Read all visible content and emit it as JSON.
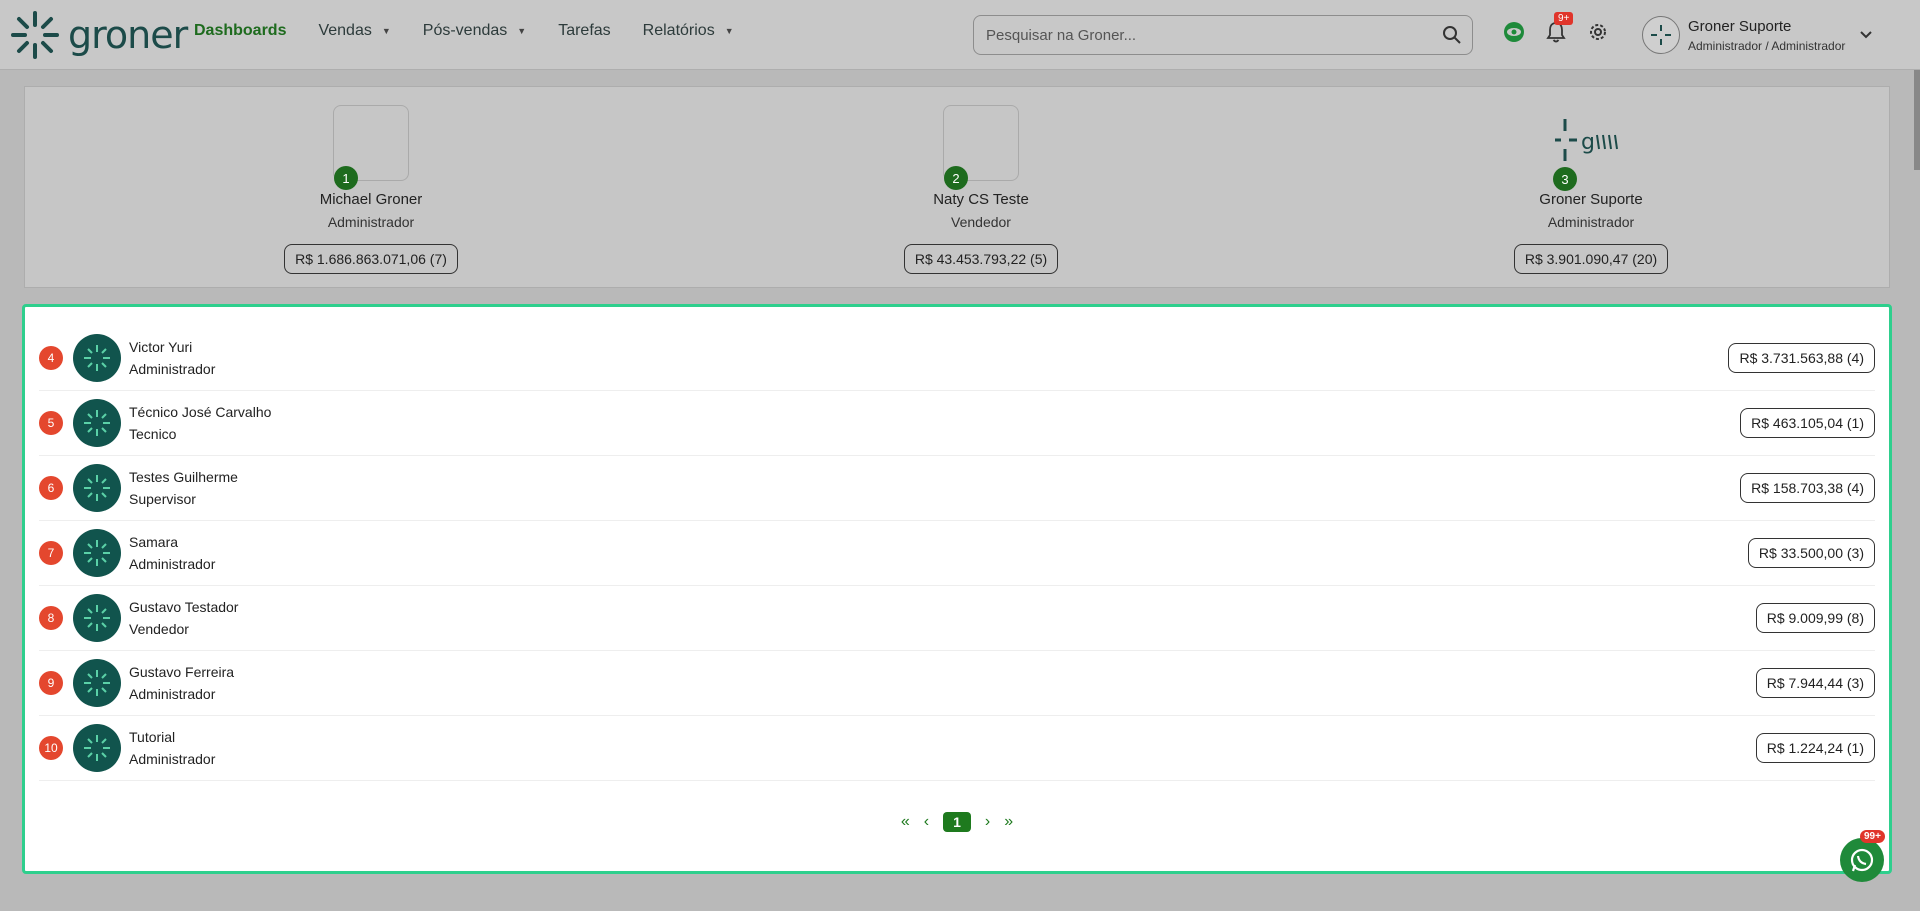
{
  "header": {
    "logo_text": "groner",
    "nav": [
      {
        "label": "Dashboards",
        "active": true,
        "dropdown": false
      },
      {
        "label": "Vendas",
        "active": false,
        "dropdown": true
      },
      {
        "label": "Pós-vendas",
        "active": false,
        "dropdown": true
      },
      {
        "label": "Tarefas",
        "active": false,
        "dropdown": false
      },
      {
        "label": "Relatórios",
        "active": false,
        "dropdown": true
      }
    ],
    "search_placeholder": "Pesquisar na Groner...",
    "notification_count": "9+",
    "user": {
      "name": "Groner Suporte",
      "role": "Administrador / Administrador"
    }
  },
  "podium": [
    {
      "rank": "1",
      "name": "Michael Groner",
      "role": "Administrador",
      "value": "R$ 1.686.863.071,06 (7)"
    },
    {
      "rank": "2",
      "name": "Naty CS Teste",
      "role": "Vendedor",
      "value": "R$ 43.453.793,22 (5)"
    },
    {
      "rank": "3",
      "name": "Groner Suporte",
      "role": "Administrador",
      "value": "R$ 3.901.090,47 (20)"
    }
  ],
  "ranking": [
    {
      "rank": "4",
      "name": "Victor Yuri",
      "role": "Administrador",
      "value": "R$ 3.731.563,88 (4)"
    },
    {
      "rank": "5",
      "name": "Técnico José Carvalho",
      "role": "Tecnico",
      "value": "R$ 463.105,04 (1)"
    },
    {
      "rank": "6",
      "name": "Testes Guilherme",
      "role": "Supervisor",
      "value": "R$ 158.703,38 (4)"
    },
    {
      "rank": "7",
      "name": "Samara",
      "role": "Administrador",
      "value": "R$ 33.500,00 (3)"
    },
    {
      "rank": "8",
      "name": "Gustavo Testador",
      "role": "Vendedor",
      "value": "R$ 9.009,99 (8)"
    },
    {
      "rank": "9",
      "name": "Gustavo Ferreira",
      "role": "Administrador",
      "value": "R$ 7.944,44 (3)"
    },
    {
      "rank": "10",
      "name": "Tutorial",
      "role": "Administrador",
      "value": "R$ 1.224,24 (1)"
    }
  ],
  "pagination": {
    "first": "«",
    "prev": "‹",
    "current": "1",
    "next": "›",
    "last": "»"
  },
  "whatsapp_badge": "99+",
  "colors": {
    "accent": "#1e6b1e",
    "rank_red": "#e4472e",
    "border_green": "#2ecf8d",
    "avatar": "#11544d"
  }
}
